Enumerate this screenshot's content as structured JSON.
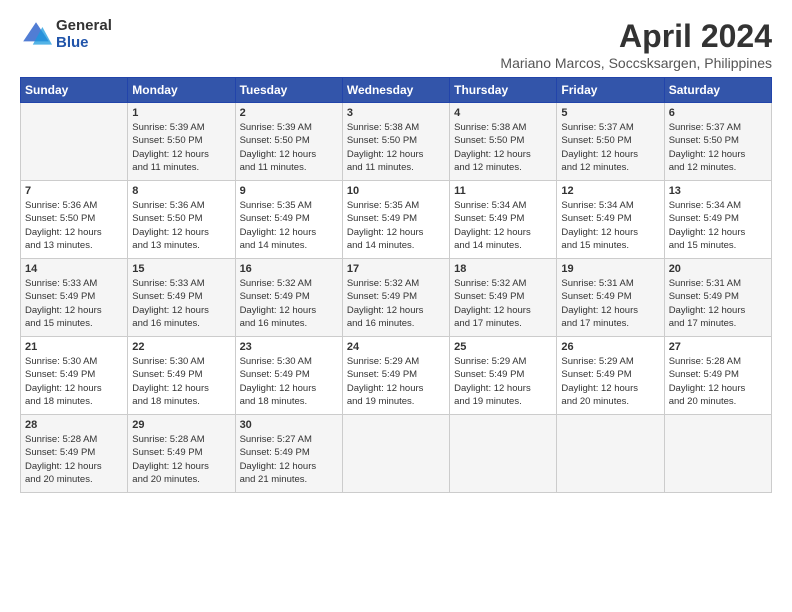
{
  "logo": {
    "general": "General",
    "blue": "Blue"
  },
  "title": "April 2024",
  "subtitle": "Mariano Marcos, Soccsksargen, Philippines",
  "days_of_week": [
    "Sunday",
    "Monday",
    "Tuesday",
    "Wednesday",
    "Thursday",
    "Friday",
    "Saturday"
  ],
  "weeks": [
    [
      {
        "day": "",
        "info": ""
      },
      {
        "day": "1",
        "info": "Sunrise: 5:39 AM\nSunset: 5:50 PM\nDaylight: 12 hours\nand 11 minutes."
      },
      {
        "day": "2",
        "info": "Sunrise: 5:39 AM\nSunset: 5:50 PM\nDaylight: 12 hours\nand 11 minutes."
      },
      {
        "day": "3",
        "info": "Sunrise: 5:38 AM\nSunset: 5:50 PM\nDaylight: 12 hours\nand 11 minutes."
      },
      {
        "day": "4",
        "info": "Sunrise: 5:38 AM\nSunset: 5:50 PM\nDaylight: 12 hours\nand 12 minutes."
      },
      {
        "day": "5",
        "info": "Sunrise: 5:37 AM\nSunset: 5:50 PM\nDaylight: 12 hours\nand 12 minutes."
      },
      {
        "day": "6",
        "info": "Sunrise: 5:37 AM\nSunset: 5:50 PM\nDaylight: 12 hours\nand 12 minutes."
      }
    ],
    [
      {
        "day": "7",
        "info": "Sunrise: 5:36 AM\nSunset: 5:50 PM\nDaylight: 12 hours\nand 13 minutes."
      },
      {
        "day": "8",
        "info": "Sunrise: 5:36 AM\nSunset: 5:50 PM\nDaylight: 12 hours\nand 13 minutes."
      },
      {
        "day": "9",
        "info": "Sunrise: 5:35 AM\nSunset: 5:49 PM\nDaylight: 12 hours\nand 14 minutes."
      },
      {
        "day": "10",
        "info": "Sunrise: 5:35 AM\nSunset: 5:49 PM\nDaylight: 12 hours\nand 14 minutes."
      },
      {
        "day": "11",
        "info": "Sunrise: 5:34 AM\nSunset: 5:49 PM\nDaylight: 12 hours\nand 14 minutes."
      },
      {
        "day": "12",
        "info": "Sunrise: 5:34 AM\nSunset: 5:49 PM\nDaylight: 12 hours\nand 15 minutes."
      },
      {
        "day": "13",
        "info": "Sunrise: 5:34 AM\nSunset: 5:49 PM\nDaylight: 12 hours\nand 15 minutes."
      }
    ],
    [
      {
        "day": "14",
        "info": "Sunrise: 5:33 AM\nSunset: 5:49 PM\nDaylight: 12 hours\nand 15 minutes."
      },
      {
        "day": "15",
        "info": "Sunrise: 5:33 AM\nSunset: 5:49 PM\nDaylight: 12 hours\nand 16 minutes."
      },
      {
        "day": "16",
        "info": "Sunrise: 5:32 AM\nSunset: 5:49 PM\nDaylight: 12 hours\nand 16 minutes."
      },
      {
        "day": "17",
        "info": "Sunrise: 5:32 AM\nSunset: 5:49 PM\nDaylight: 12 hours\nand 16 minutes."
      },
      {
        "day": "18",
        "info": "Sunrise: 5:32 AM\nSunset: 5:49 PM\nDaylight: 12 hours\nand 17 minutes."
      },
      {
        "day": "19",
        "info": "Sunrise: 5:31 AM\nSunset: 5:49 PM\nDaylight: 12 hours\nand 17 minutes."
      },
      {
        "day": "20",
        "info": "Sunrise: 5:31 AM\nSunset: 5:49 PM\nDaylight: 12 hours\nand 17 minutes."
      }
    ],
    [
      {
        "day": "21",
        "info": "Sunrise: 5:30 AM\nSunset: 5:49 PM\nDaylight: 12 hours\nand 18 minutes."
      },
      {
        "day": "22",
        "info": "Sunrise: 5:30 AM\nSunset: 5:49 PM\nDaylight: 12 hours\nand 18 minutes."
      },
      {
        "day": "23",
        "info": "Sunrise: 5:30 AM\nSunset: 5:49 PM\nDaylight: 12 hours\nand 18 minutes."
      },
      {
        "day": "24",
        "info": "Sunrise: 5:29 AM\nSunset: 5:49 PM\nDaylight: 12 hours\nand 19 minutes."
      },
      {
        "day": "25",
        "info": "Sunrise: 5:29 AM\nSunset: 5:49 PM\nDaylight: 12 hours\nand 19 minutes."
      },
      {
        "day": "26",
        "info": "Sunrise: 5:29 AM\nSunset: 5:49 PM\nDaylight: 12 hours\nand 20 minutes."
      },
      {
        "day": "27",
        "info": "Sunrise: 5:28 AM\nSunset: 5:49 PM\nDaylight: 12 hours\nand 20 minutes."
      }
    ],
    [
      {
        "day": "28",
        "info": "Sunrise: 5:28 AM\nSunset: 5:49 PM\nDaylight: 12 hours\nand 20 minutes."
      },
      {
        "day": "29",
        "info": "Sunrise: 5:28 AM\nSunset: 5:49 PM\nDaylight: 12 hours\nand 20 minutes."
      },
      {
        "day": "30",
        "info": "Sunrise: 5:27 AM\nSunset: 5:49 PM\nDaylight: 12 hours\nand 21 minutes."
      },
      {
        "day": "",
        "info": ""
      },
      {
        "day": "",
        "info": ""
      },
      {
        "day": "",
        "info": ""
      },
      {
        "day": "",
        "info": ""
      }
    ]
  ]
}
